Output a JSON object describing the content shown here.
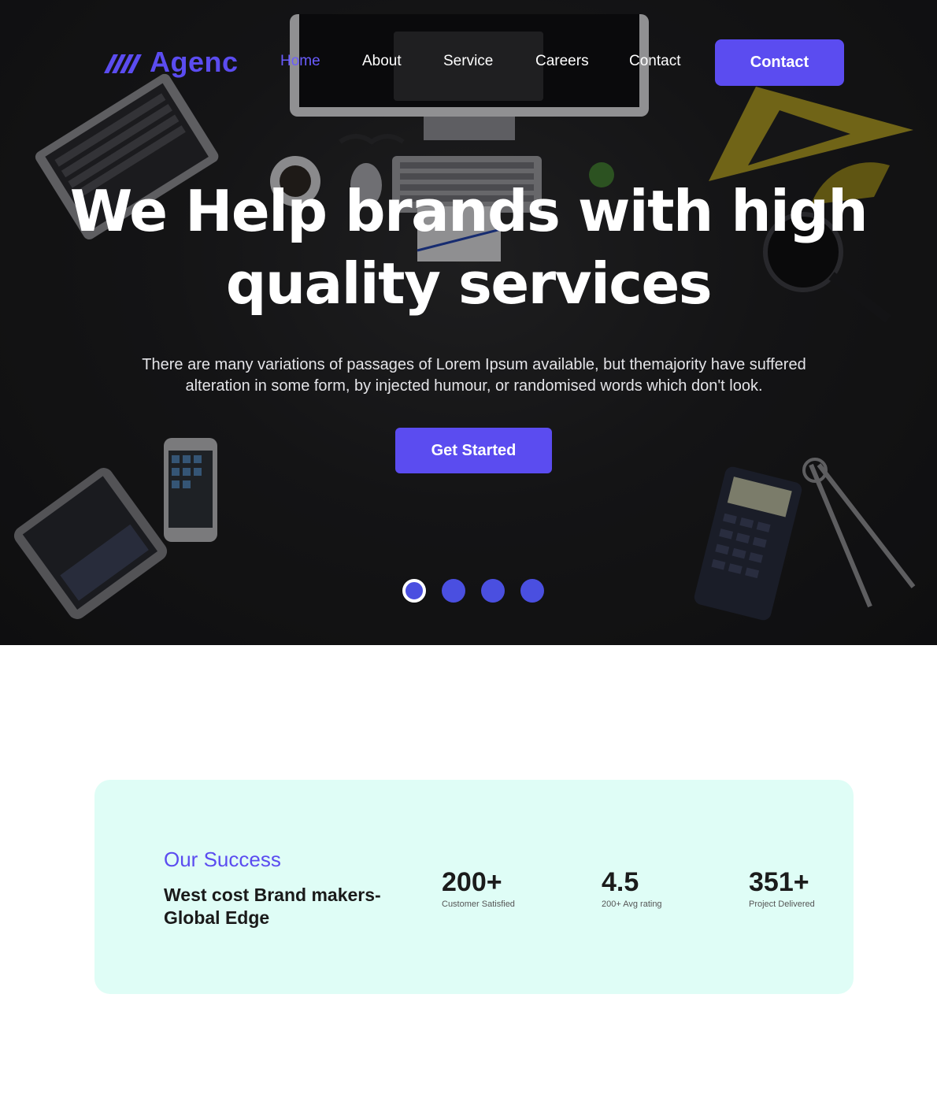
{
  "brand": {
    "name": "Agenc",
    "accent_color": "#5b4cf0",
    "logo_icon": "slashes-logo-icon"
  },
  "nav": {
    "links": [
      {
        "label": "Home",
        "active": true
      },
      {
        "label": "About",
        "active": false
      },
      {
        "label": "Service",
        "active": false
      },
      {
        "label": "Careers",
        "active": false
      },
      {
        "label": "Contact",
        "active": false
      }
    ],
    "cta_label": "Contact"
  },
  "hero": {
    "headline": "We Help brands with high quality services",
    "subtext": "There are many variations of passages of Lorem Ipsum available, but themajority have suffered alteration in some form, by injected humour, or randomised words which don't look.",
    "button_label": "Get Started",
    "slider": {
      "total": 4,
      "active_index": 0
    }
  },
  "success": {
    "label": "Our Success",
    "title": "West cost Brand makers-Global Edge",
    "background_color": "#dffdf6",
    "stats": [
      {
        "value": "200+",
        "label": "Customer Satisfied"
      },
      {
        "value": "4.5",
        "label": "200+ Avg rating"
      },
      {
        "value": "351+",
        "label": "Project Delivered"
      }
    ]
  }
}
